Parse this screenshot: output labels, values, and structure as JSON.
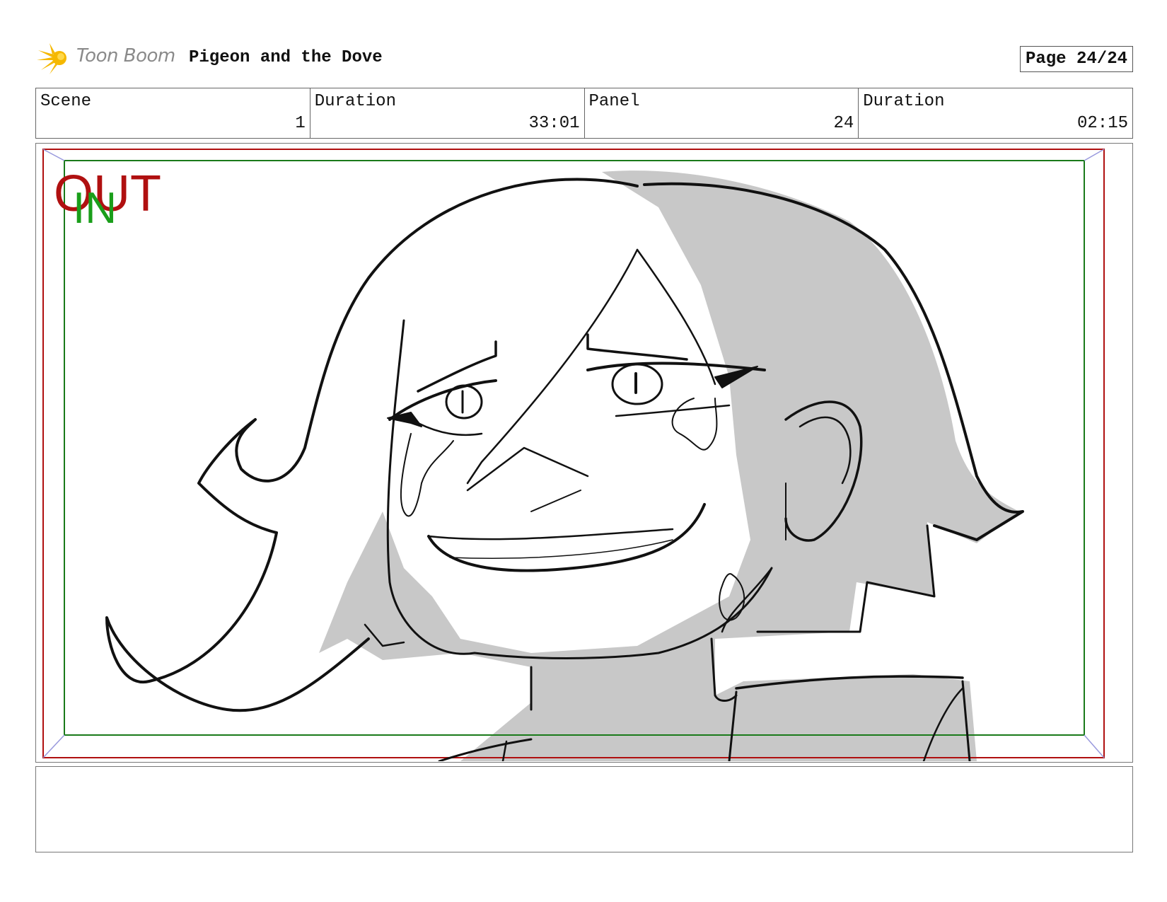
{
  "header": {
    "logo_text": "Toon Boom",
    "title": "Pigeon and the Dove",
    "page": "Page 24/24"
  },
  "info": {
    "scene_label": "Scene",
    "scene_value": "1",
    "scene_duration_label": "Duration",
    "scene_duration_value": "33:01",
    "panel_label": "Panel",
    "panel_value": "24",
    "panel_duration_label": "Duration",
    "panel_duration_value": "02:15"
  },
  "frame": {
    "out_label": "OUT",
    "in_label": "IN",
    "out_color": "#b01010",
    "in_color": "#1a9e1a"
  },
  "notes": {
    "text": ""
  }
}
